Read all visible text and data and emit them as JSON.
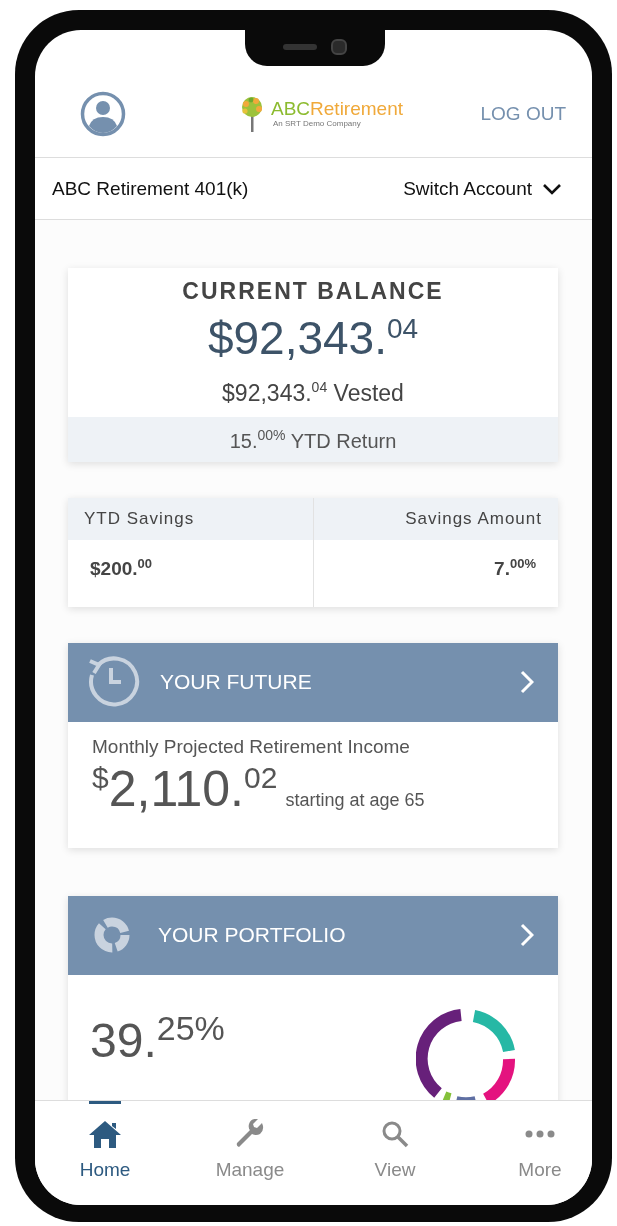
{
  "header": {
    "logo": {
      "brand": "ABC",
      "name": "Retirement",
      "tagline": "An SRT Demo Company"
    },
    "logout": "LOG OUT"
  },
  "account": {
    "name": "ABC Retirement 401(k)",
    "switch": "Switch Account"
  },
  "balance": {
    "title": "CURRENT BALANCE",
    "amount": "$92,343.$^{04}$",
    "vested": "$92,343.$^{04}$ Vested",
    "ytd_return": "15.$^{00%}$ YTD Return"
  },
  "savings": [
    {
      "label": "YTD Savings",
      "value": "$200.$^{00}$"
    },
    {
      "label": "Savings Amount",
      "value": "7.$^{00%}$"
    }
  ],
  "future": {
    "title": "YOUR FUTURE",
    "caption": "Monthly Projected Retirement Income",
    "symbol": "$",
    "whole": "2,110.",
    "cents": "02",
    "note": "starting at age 65"
  },
  "portfolio": {
    "title": "YOUR PORTFOLIO",
    "percent": "39.$^{25%}$"
  },
  "tabs": [
    {
      "label": "Home",
      "kind": "home",
      "selected": true
    },
    {
      "label": "Manage",
      "kind": "wrench",
      "selected": false
    },
    {
      "label": "View",
      "kind": "search",
      "selected": false
    },
    {
      "label": "More",
      "kind": "dots",
      "selected": false
    }
  ]
}
